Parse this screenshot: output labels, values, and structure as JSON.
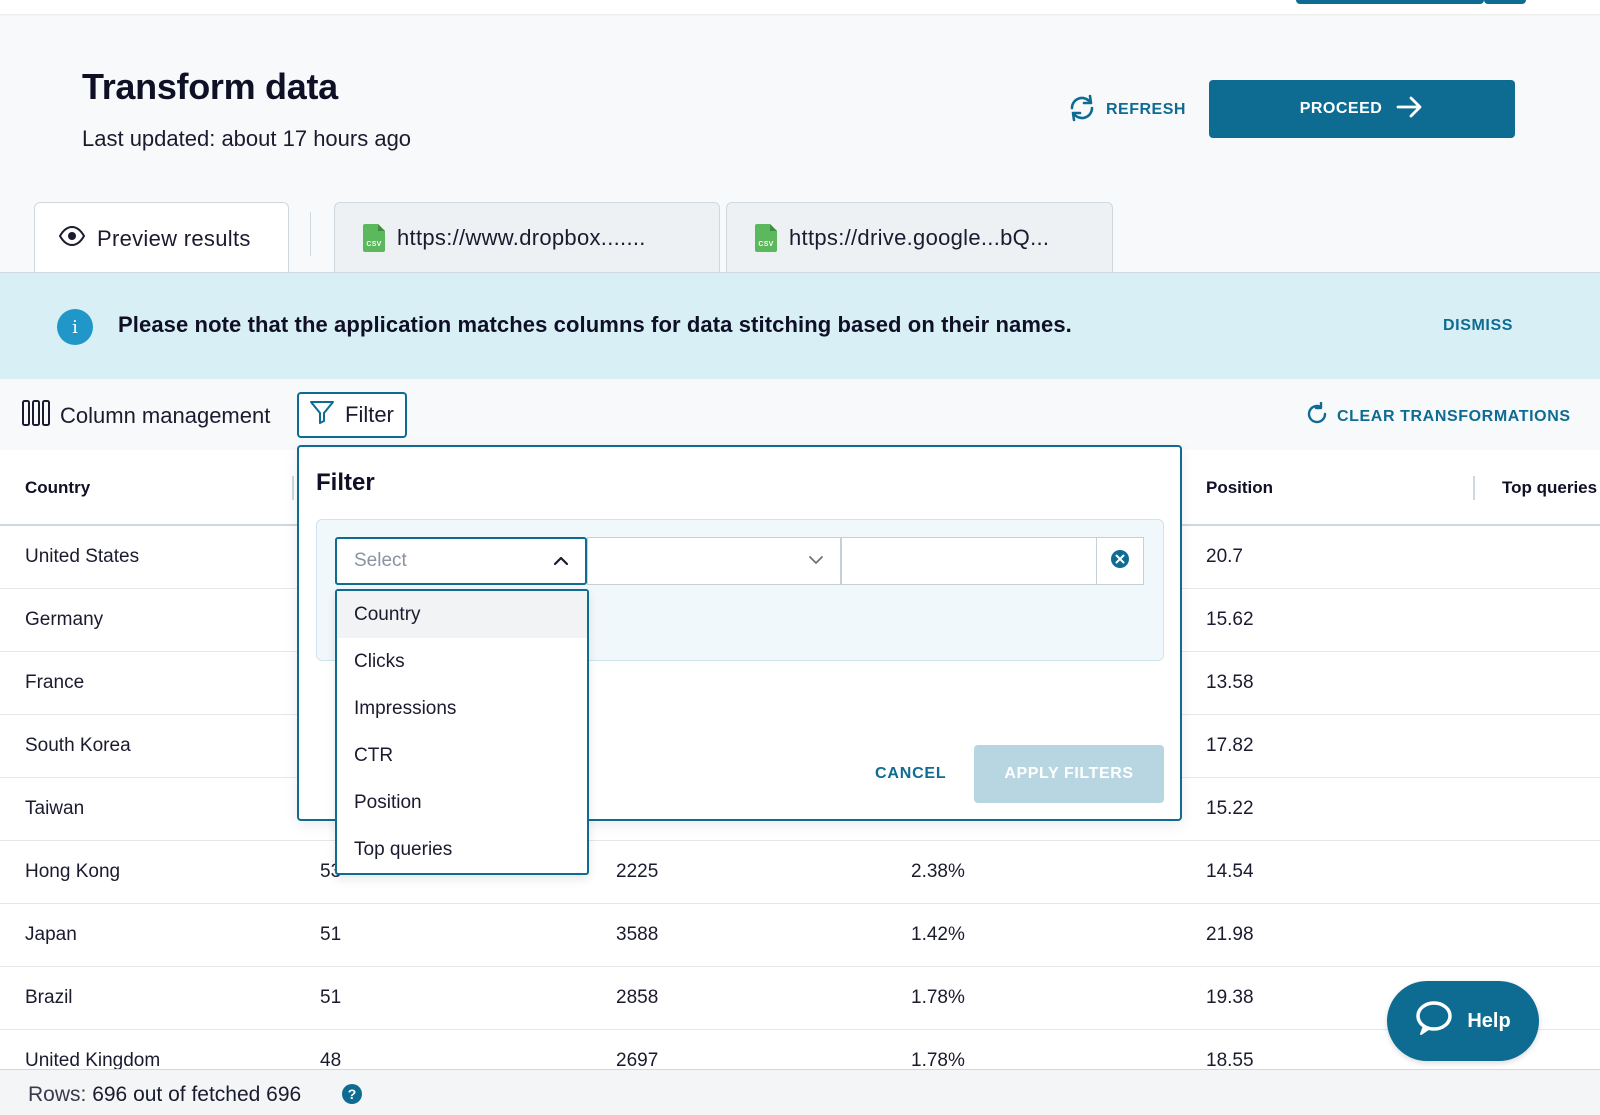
{
  "header": {
    "title": "Transform data",
    "last_updated": "Last updated: about 17 hours ago",
    "refresh_label": "REFRESH",
    "proceed_label": "PROCEED"
  },
  "tabs": [
    {
      "label": "Preview results",
      "icon": "eye-icon",
      "active": true
    },
    {
      "label": "https://www.dropbox.......",
      "icon": "csv-file-icon",
      "active": false
    },
    {
      "label": "https://drive.google...bQ...",
      "icon": "csv-file-icon",
      "active": false
    }
  ],
  "banner": {
    "message": "Please note that the application matches columns for data stitching based on their names.",
    "dismiss_label": "DISMISS",
    "icon_glyph": "i"
  },
  "toolbar": {
    "column_management_label": "Column management",
    "filter_label": "Filter",
    "clear_transformations_label": "CLEAR TRANSFORMATIONS"
  },
  "table": {
    "columns": [
      "Country",
      "Clicks",
      "Impressions",
      "CTR",
      "Position",
      "Top queries"
    ],
    "rows": [
      [
        "United States",
        "",
        "",
        "",
        "20.7",
        ""
      ],
      [
        "Germany",
        "",
        "",
        "",
        "15.62",
        ""
      ],
      [
        "France",
        "",
        "",
        "",
        "13.58",
        ""
      ],
      [
        "South Korea",
        "",
        "",
        "",
        "17.82",
        ""
      ],
      [
        "Taiwan",
        "",
        "",
        "",
        "15.22",
        ""
      ],
      [
        "Hong Kong",
        "53",
        "2225",
        "2.38%",
        "14.54",
        ""
      ],
      [
        "Japan",
        "51",
        "3588",
        "1.42%",
        "21.98",
        ""
      ],
      [
        "Brazil",
        "51",
        "2858",
        "1.78%",
        "19.38",
        ""
      ],
      [
        "United Kingdom",
        "48",
        "2697",
        "1.78%",
        "18.55",
        ""
      ]
    ]
  },
  "filter_panel": {
    "title": "Filter",
    "select_placeholder": "Select",
    "options": [
      "Country",
      "Clicks",
      "Impressions",
      "CTR",
      "Position",
      "Top queries"
    ],
    "hovered_option": "Country",
    "value_placeholder": "",
    "cancel_label": "CANCEL",
    "apply_label": "APPLY FILTERS"
  },
  "footer": {
    "rows_label": "Rows:",
    "rows_value": "696 out of fetched 696",
    "help_glyph": "?"
  },
  "help_button": {
    "label": "Help"
  },
  "colors": {
    "primary": "#0e6c93",
    "banner_bg": "#d8eff5",
    "info_icon": "#2196c9",
    "csv_green": "#5cb85c",
    "apply_disabled": "#b7d6e2"
  }
}
